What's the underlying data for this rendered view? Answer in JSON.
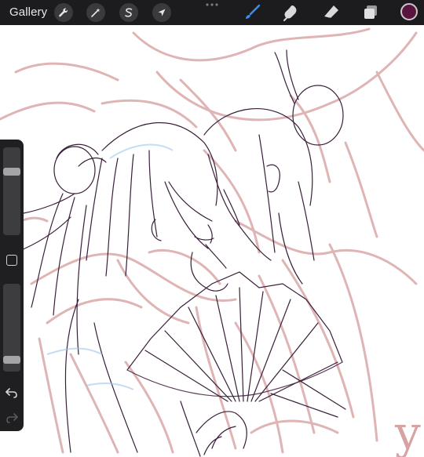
{
  "toolbar": {
    "gallery_label": "Gallery",
    "left_tools": [
      {
        "name": "actions",
        "icon": "wrench-icon"
      },
      {
        "name": "adjustments",
        "icon": "magic-wand-icon"
      },
      {
        "name": "selection",
        "icon": "selection-s-icon"
      },
      {
        "name": "transform",
        "icon": "arrow-cursor-icon"
      }
    ],
    "more_icon": "more-dots-icon",
    "right_tools": [
      {
        "name": "brush",
        "icon": "brush-icon",
        "active": true
      },
      {
        "name": "smudge",
        "icon": "smudge-icon",
        "active": false
      },
      {
        "name": "eraser",
        "icon": "eraser-icon",
        "active": false
      },
      {
        "name": "layers",
        "icon": "layers-icon",
        "active": false
      }
    ],
    "current_color": "#5a1440"
  },
  "sidebar": {
    "brush_size_level": 0.75,
    "opacity_level": 0.1,
    "modify_icon": "square-icon",
    "undo_icon": "undo-icon",
    "redo_icon": "redo-icon"
  },
  "canvas": {
    "signature": "y",
    "colors": {
      "sketch": "#c98a8a",
      "lineart": "#3a1f3a",
      "accent": "#3b7bdc"
    }
  }
}
